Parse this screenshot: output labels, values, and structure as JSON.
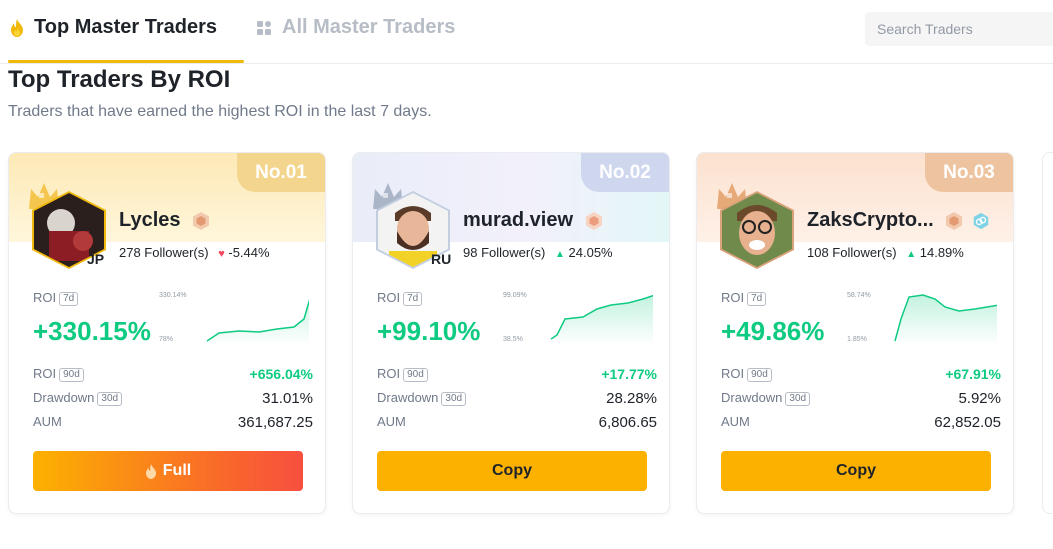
{
  "tabs": [
    {
      "label": "Top Master Traders",
      "icon": "flame-icon",
      "active": true
    },
    {
      "label": "All Master Traders",
      "icon": "grid-icon",
      "active": false
    }
  ],
  "search": {
    "placeholder": "Search Traders"
  },
  "page": {
    "title": "Top Traders By ROI",
    "subtitle": "Traders that have earned the highest ROI in the last 7 days."
  },
  "colors": {
    "accent": "#f0b90b",
    "positive": "#0ecb81",
    "negative": "#f6465d",
    "button": "#fcb100"
  },
  "labels": {
    "roi": "ROI",
    "d7": "7d",
    "d90": "90d",
    "d30": "30d",
    "drawdown": "Drawdown",
    "aum": "AUM"
  },
  "cards": [
    {
      "rank": "No.01",
      "name": "Lycles",
      "country": "JP",
      "followers": "278 Follower(s)",
      "change": "-5.44%",
      "change_direction": "down",
      "roi_7d": "+330.15%",
      "spark_max": "330.14%",
      "spark_min": "78%",
      "roi_90d": "+656.04%",
      "drawdown_30d": "31.01%",
      "aum": "361,687.25",
      "button": "Full",
      "button_state": "full"
    },
    {
      "rank": "No.02",
      "name": "murad.view",
      "country": "RU",
      "followers": "98 Follower(s)",
      "change": "24.05%",
      "change_direction": "up",
      "roi_7d": "+99.10%",
      "spark_max": "99.09%",
      "spark_min": "38.5%",
      "roi_90d": "+17.77%",
      "drawdown_30d": "28.28%",
      "aum": "6,806.65",
      "button": "Copy",
      "button_state": "copy"
    },
    {
      "rank": "No.03",
      "name": "ZaksCrypto...",
      "country": "",
      "followers": "108 Follower(s)",
      "change": "14.89%",
      "change_direction": "up",
      "roi_7d": "+49.86%",
      "spark_max": "58.74%",
      "spark_min": "1.85%",
      "roi_90d": "+67.91%",
      "drawdown_30d": "5.92%",
      "aum": "62,852.05",
      "button": "Copy",
      "button_state": "copy"
    }
  ]
}
